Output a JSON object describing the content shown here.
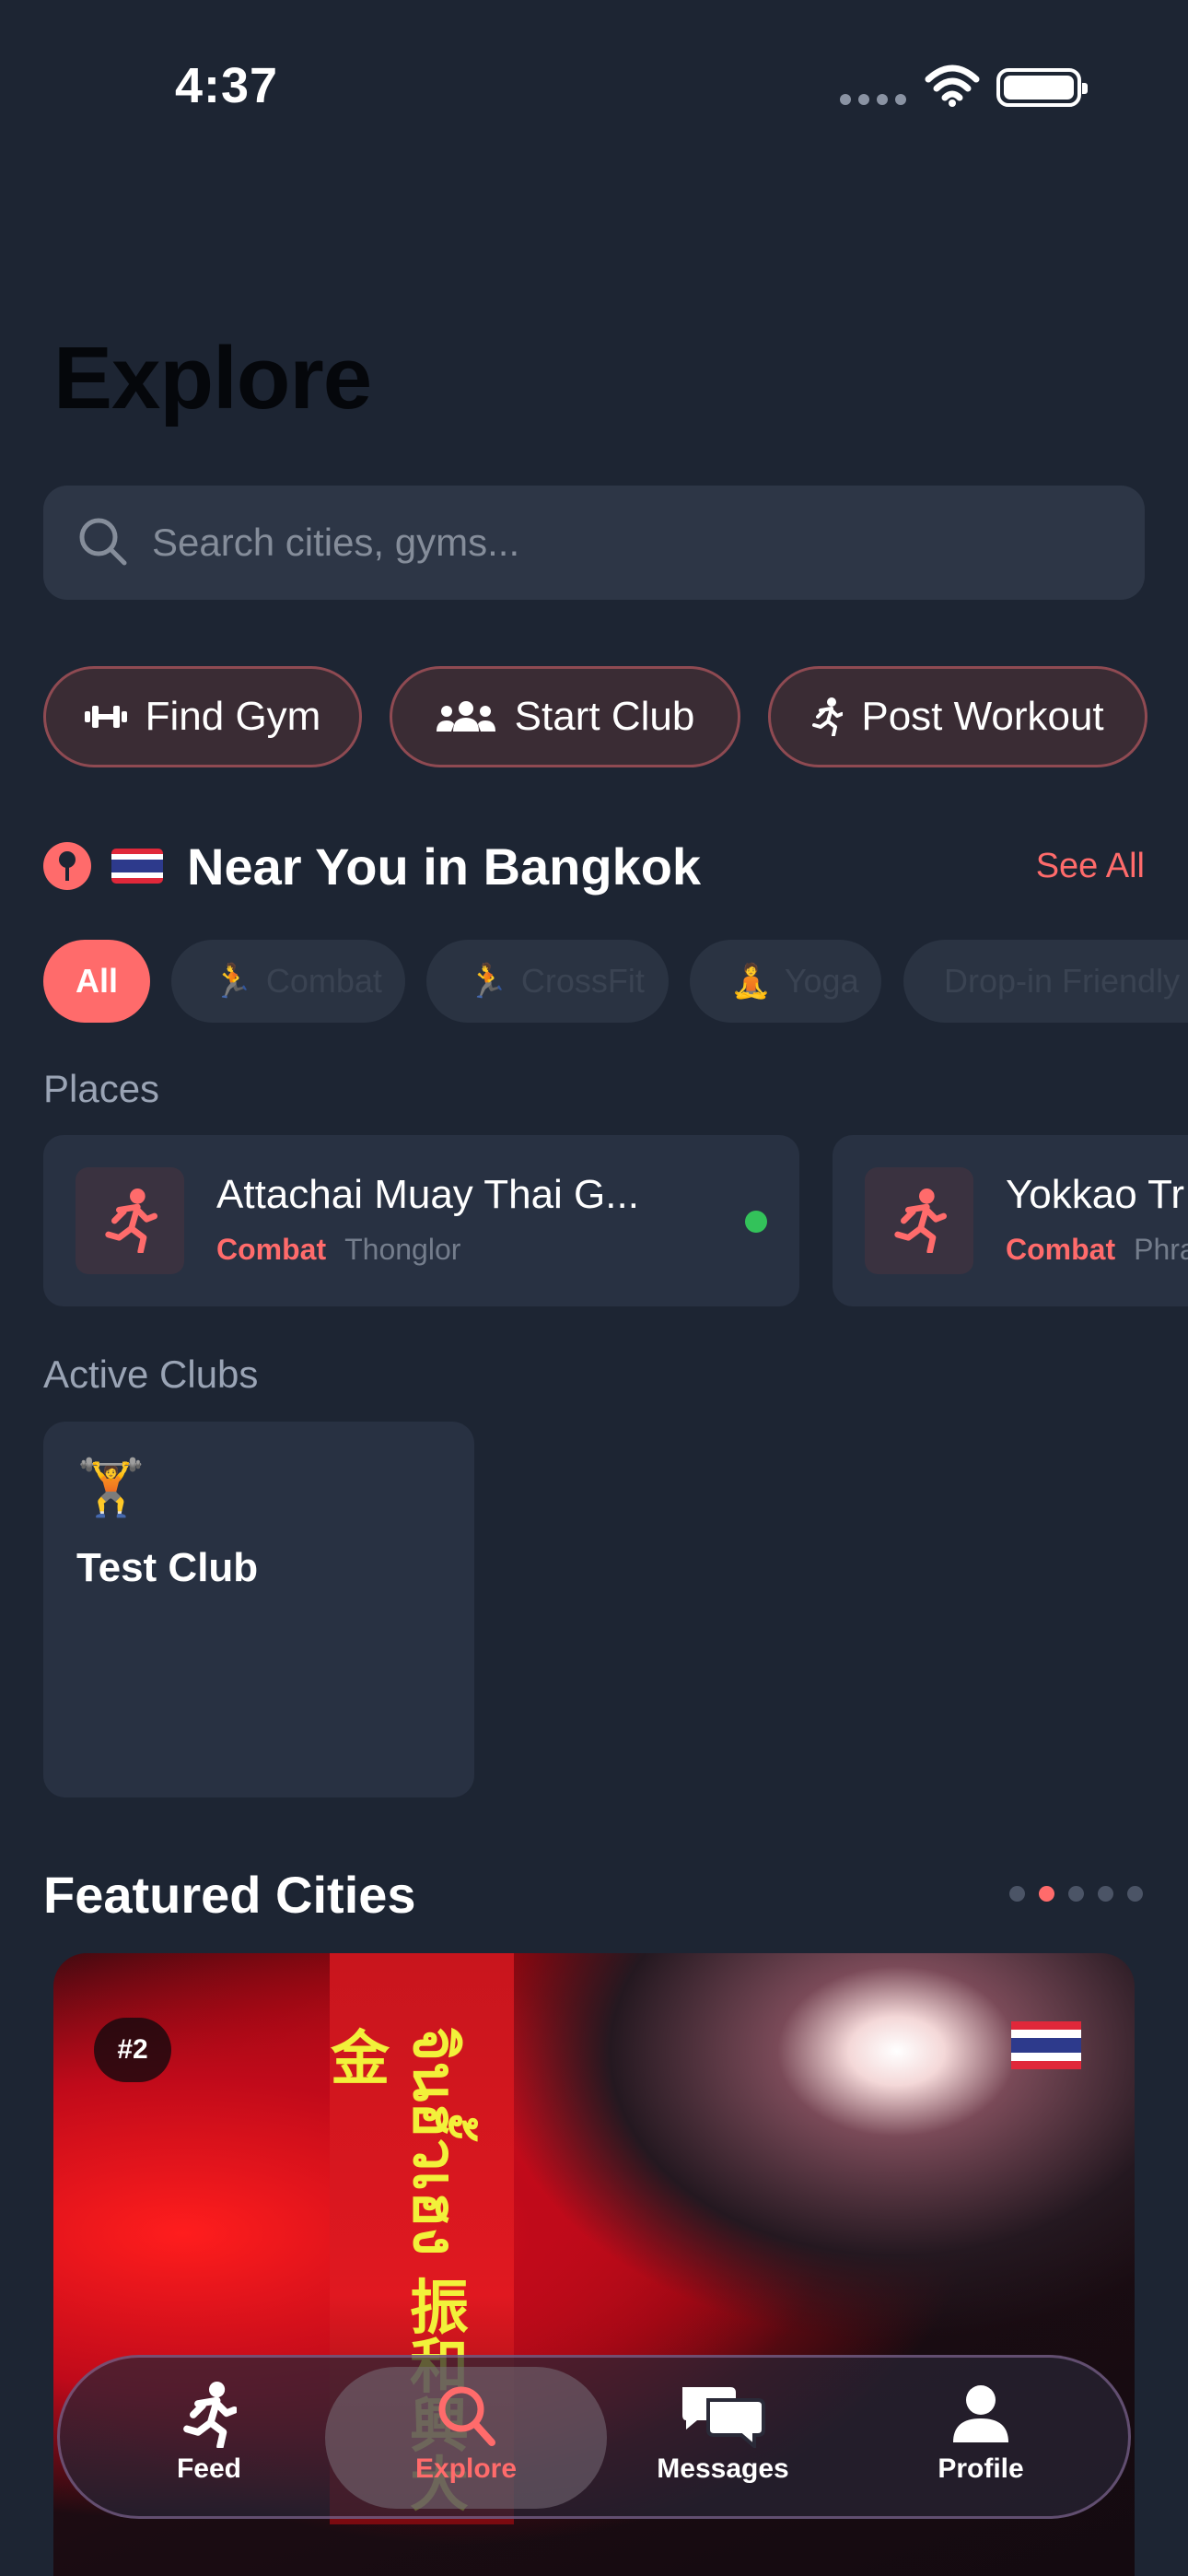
{
  "status_bar": {
    "time": "4:37"
  },
  "page": {
    "title": "Explore"
  },
  "search": {
    "placeholder": "Search cities, gyms..."
  },
  "actions": [
    {
      "label": "Find Gym",
      "icon": "dumbbell-icon"
    },
    {
      "label": "Start Club",
      "icon": "group-icon"
    },
    {
      "label": "Post Workout",
      "icon": "runner-icon"
    }
  ],
  "near_you": {
    "title": "Near You in Bangkok",
    "see_all": "See All",
    "flag": "thailand-flag-icon"
  },
  "filters": [
    {
      "label": "All",
      "active": true
    },
    {
      "label": "Combat",
      "active": false
    },
    {
      "label": "CrossFit",
      "active": false
    },
    {
      "label": "Yoga",
      "active": false
    },
    {
      "label": "Drop-in Friendly",
      "active": false
    }
  ],
  "places": {
    "label": "Places",
    "items": [
      {
        "name": "Attachai Muay Thai G...",
        "category": "Combat",
        "location": "Thonglor",
        "online": true
      },
      {
        "name": "Yokkao Tr",
        "category": "Combat",
        "location": "Phra"
      }
    ]
  },
  "clubs": {
    "label": "Active Clubs",
    "items": [
      {
        "name": "Test Club",
        "emoji": "🏋️"
      }
    ]
  },
  "featured": {
    "title": "Featured Cities",
    "pages": 5,
    "current_page": 2,
    "card": {
      "rank": "#2",
      "sign_text": "จินฮั้วเฮง 振和興大金"
    }
  },
  "tabbar": {
    "tabs": [
      {
        "label": "Feed",
        "icon": "runner-icon"
      },
      {
        "label": "Explore",
        "icon": "search-icon",
        "selected": true
      },
      {
        "label": "Messages",
        "icon": "chat-bubbles-icon"
      },
      {
        "label": "Profile",
        "icon": "person-icon"
      }
    ]
  },
  "colors": {
    "accent": "#ff6b6b",
    "background": "#1d2533",
    "card": "#283142",
    "online": "#33c25a"
  }
}
